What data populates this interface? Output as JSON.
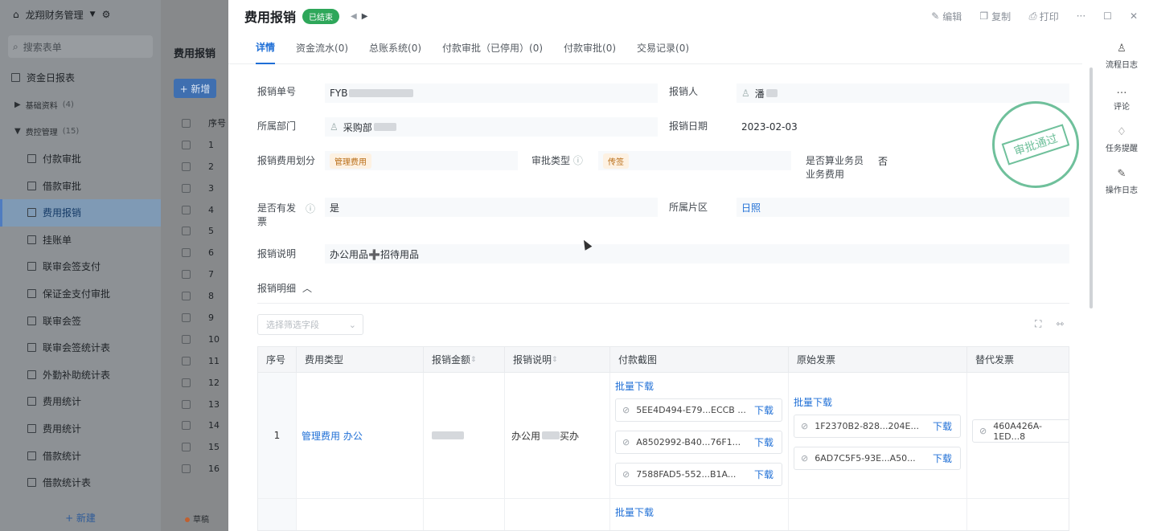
{
  "app": {
    "name": "龙翔财务管理"
  },
  "left": {
    "search_placeholder": "搜索表单",
    "nav": [
      {
        "label": "资金日报表",
        "type": "top"
      },
      {
        "label": "基础资料",
        "count": "(4)",
        "type": "group",
        "caret": "▶"
      },
      {
        "label": "费控管理",
        "count": "(15)",
        "type": "group",
        "caret": "▼"
      },
      {
        "label": "付款审批",
        "type": "sub"
      },
      {
        "label": "借款审批",
        "type": "sub"
      },
      {
        "label": "费用报销",
        "type": "sub",
        "active": true
      },
      {
        "label": "挂账单",
        "type": "sub"
      },
      {
        "label": "联审会签支付",
        "type": "sub"
      },
      {
        "label": "保证金支付审批",
        "type": "sub"
      },
      {
        "label": "联审会签",
        "type": "sub"
      },
      {
        "label": "联审会签统计表",
        "type": "sub"
      },
      {
        "label": "外勤补助统计表",
        "type": "sub"
      },
      {
        "label": "费用统计",
        "type": "sub"
      },
      {
        "label": "费用统计",
        "type": "sub"
      },
      {
        "label": "借款统计",
        "type": "sub"
      },
      {
        "label": "借款统计表",
        "type": "sub"
      }
    ],
    "new_label": "+ 新建"
  },
  "mid": {
    "title": "费用报销",
    "add_label": "+ 新增",
    "col_header": "序号",
    "rows": [
      "1",
      "2",
      "3",
      "4",
      "5",
      "6",
      "7",
      "8",
      "9",
      "10",
      "11",
      "12",
      "13",
      "14",
      "15",
      "16"
    ],
    "footer": "草稿"
  },
  "panel": {
    "title": "费用报销",
    "status": "已结束",
    "actions": {
      "edit": "编辑",
      "copy": "复制",
      "print": "打印",
      "more": "···"
    },
    "tabs": [
      "详情",
      "资金流水(0)",
      "总账系统(0)",
      "付款审批（已停用）(0)",
      "付款审批(0)",
      "交易记录(0)"
    ],
    "side_actions": [
      "流程日志",
      "评论",
      "任务提醒",
      "操作日志"
    ],
    "fields": {
      "no_label": "报销单号",
      "no_value": "FYB",
      "person_label": "报销人",
      "person_value": "潘",
      "dept_label": "所属部门",
      "dept_value": "采购部",
      "date_label": "报销日期",
      "date_value": "2023-02-03",
      "division_label": "报销费用划分",
      "division_value": "管理费用",
      "approval_label": "审批类型",
      "approval_value": "传签",
      "biz_label": "是否算业务员业务费用",
      "biz_value": "否",
      "invoice_label": "是否有发票",
      "invoice_value": "是",
      "region_label": "所属片区",
      "region_value": "日照",
      "desc_label": "报销说明",
      "desc_value": "办公用品➕招待用品"
    },
    "stamp": "审批通过",
    "detail": {
      "section_label": "报销明细",
      "filter_placeholder": "选择筛选字段",
      "headers": [
        "序号",
        "费用类型",
        "报销金额",
        "报销说明",
        "付款截图",
        "原始发票",
        "替代发票"
      ],
      "row": {
        "no": "1",
        "type": "管理费用 办公",
        "desc_a": "办公用",
        "desc_b": "买办",
        "batch": "批量下载",
        "pay_files": [
          "5EE4D494-E79...ECCB ...",
          "A8502992-B40...76F1...",
          "7588FAD5-552...B1A..."
        ],
        "orig_files": [
          "1F2370B2-828...204E...",
          "6AD7C5F5-93E...A50..."
        ],
        "alt_files": [
          "460A426A-1ED...8"
        ],
        "download": "下载"
      }
    }
  }
}
